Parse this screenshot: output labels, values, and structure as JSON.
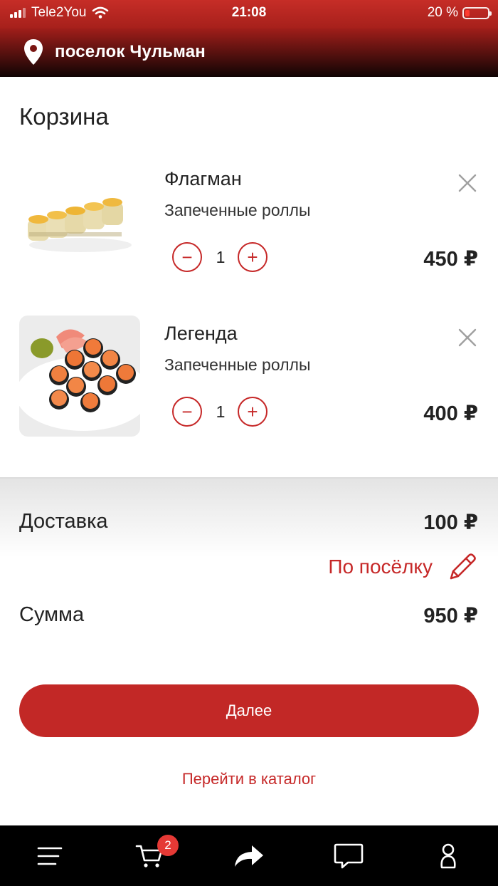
{
  "status_bar": {
    "carrier": "Tele2You",
    "time": "21:08",
    "battery": "20 %",
    "battery_level": 0.2
  },
  "location": {
    "pin_icon": "map-pin-icon",
    "name": "поселок Чульман"
  },
  "page": {
    "title": "Корзина"
  },
  "cart_items": [
    {
      "name": "Флагман",
      "category": "Запеченные роллы",
      "quantity": "1",
      "price": "450 ₽",
      "minus": "−",
      "plus": "+",
      "remove_icon": "close-icon"
    },
    {
      "name": "Легенда",
      "category": "Запеченные роллы",
      "quantity": "1",
      "price": "400 ₽",
      "minus": "−",
      "plus": "+",
      "remove_icon": "close-icon"
    }
  ],
  "summary": {
    "delivery_label": "Доставка",
    "delivery_value": "100 ₽",
    "delivery_zone": "По посёлку",
    "edit_icon": "pencil-icon",
    "total_label": "Сумма",
    "total_value": "950 ₽"
  },
  "actions": {
    "next": "Далее",
    "catalog": "Перейти в каталог"
  },
  "tab_bar": {
    "items": [
      "menu-icon",
      "cart-icon",
      "share-icon",
      "chat-icon",
      "profile-icon"
    ],
    "cart_badge": "2"
  },
  "colors": {
    "accent": "#c62828",
    "header_top": "#c62d27",
    "header_bottom": "#100404",
    "tab_bar": "#000000"
  }
}
